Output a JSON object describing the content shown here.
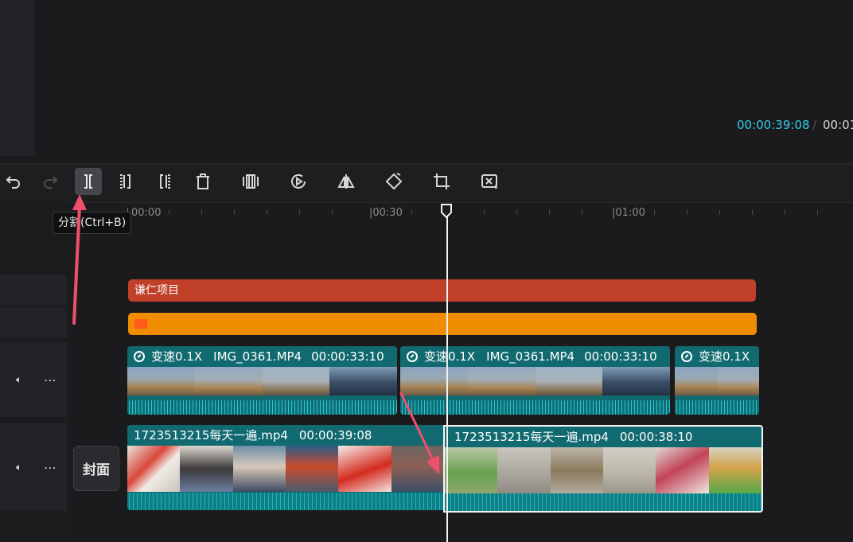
{
  "preview": {
    "current_time": "00:00:39:08",
    "separator": "/",
    "total_time": "00:01"
  },
  "toolbar": {
    "buttons": [
      {
        "id": "undo",
        "icon": "undo-icon"
      },
      {
        "id": "redo",
        "icon": "redo-icon"
      },
      {
        "id": "split",
        "icon": "split-icon"
      },
      {
        "id": "split-left",
        "icon": "split-left-icon"
      },
      {
        "id": "split-right",
        "icon": "split-right-icon"
      },
      {
        "id": "delete",
        "icon": "delete-icon"
      },
      {
        "id": "freeze",
        "icon": "freeze-frame-icon"
      },
      {
        "id": "reverse",
        "icon": "reverse-icon"
      },
      {
        "id": "mirror",
        "icon": "mirror-icon"
      },
      {
        "id": "rotate",
        "icon": "rotate-icon"
      },
      {
        "id": "crop",
        "icon": "crop-icon"
      },
      {
        "id": "smart",
        "icon": "smart-cut-icon"
      }
    ]
  },
  "tooltip": {
    "text": "分割(Ctrl+B)"
  },
  "ruler": {
    "labels": [
      "00:00",
      "|00:30",
      "|01:00"
    ]
  },
  "tracks": {
    "text_clip": {
      "label": "谦仁项目"
    },
    "folder_clip": {
      "icon": "folder-icon"
    },
    "video_clips": [
      {
        "speed": "变速0.1X",
        "name": "IMG_0361.MP4",
        "duration": "00:00:33:10"
      },
      {
        "speed": "变速0.1X",
        "name": "IMG_0361.MP4",
        "duration": "00:00:33:10"
      },
      {
        "speed": "变速0.1X",
        "name": "",
        "duration": ""
      }
    ],
    "main_clips": [
      {
        "name": "1723513215每天一遍.mp4",
        "duration": "00:00:39:08"
      },
      {
        "name": "1723513215每天一遍.mp4",
        "duration": "00:00:38:10"
      }
    ],
    "cover_label": "封面"
  },
  "colors": {
    "accent_time": "#2fd0e4",
    "text_clip": "#c0402a",
    "folder_clip": "#ef8c00",
    "video_clip": "#116a70",
    "annotation_arrow": "#f0506e"
  }
}
